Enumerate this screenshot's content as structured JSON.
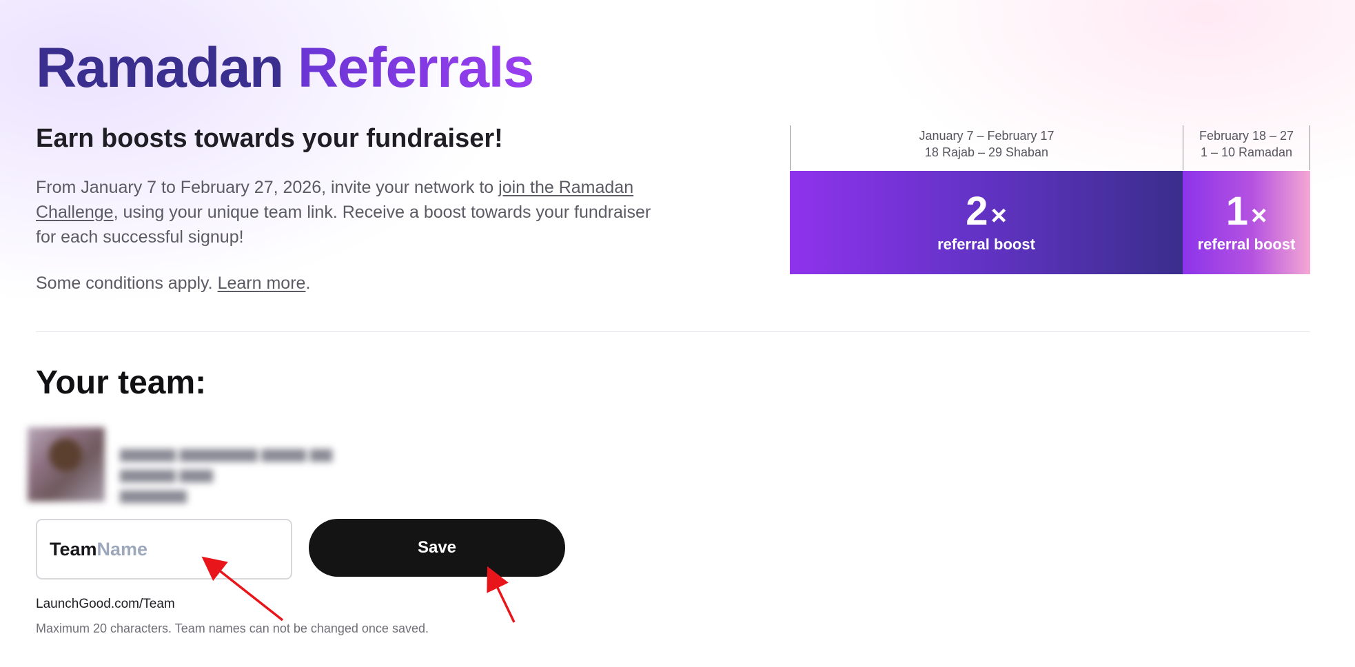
{
  "header": {
    "title_part1": "Ramadan",
    "title_part2": "Referrals"
  },
  "intro": {
    "subtitle": "Earn boosts towards your fundraiser!",
    "desc_before": "From January 7 to February 27, 2026, invite your network to ",
    "desc_link": "join the Ramadan Challenge",
    "desc_after": ", using your unique team link. Receive a boost towards your fundraiser for each successful signup!",
    "conditions_before": "Some conditions apply. ",
    "conditions_link": "Learn more",
    "conditions_after": "."
  },
  "timeline": {
    "phases": [
      {
        "date_gregorian": "January 7 – February 17",
        "date_hijri": "18 Rajab – 29 Shaban",
        "multiplier": "2",
        "multiplier_suffix": "×",
        "label": "referral boost"
      },
      {
        "date_gregorian": "February 18 – 27",
        "date_hijri": "1 – 10 Ramadan",
        "multiplier": "1",
        "multiplier_suffix": "×",
        "label": "referral boost"
      }
    ]
  },
  "team": {
    "heading": "Your team:",
    "input_prefix": "Team",
    "input_placeholder": "Name",
    "save_label": "Save",
    "url_label": "LaunchGood.com/Team",
    "hint": "Maximum 20 characters. Team names can not be changed once saved."
  },
  "colors": {
    "title_dark": "#3a2f8f",
    "title_accent": "#9a3ff0",
    "button_bg": "#141414",
    "annotation_arrow": "#e8161b"
  }
}
